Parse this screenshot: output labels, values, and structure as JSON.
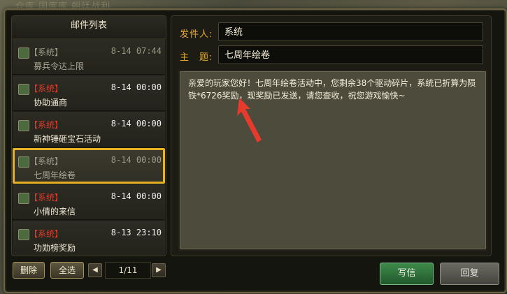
{
  "backdrop_tabs": "仓库  国库库  朝廷战利",
  "mail_list": {
    "title": "邮件列表",
    "items": [
      {
        "tag": "【系统】",
        "date": "8-14 07:44",
        "subject": "募兵令达上限",
        "read": true
      },
      {
        "tag": "【系统】",
        "date": "8-14 00:00",
        "subject": "协助通商",
        "read": false
      },
      {
        "tag": "【系统】",
        "date": "8-14 00:00",
        "subject": "新神锤砸宝石活动",
        "read": false
      },
      {
        "tag": "【系统】",
        "date": "8-14 00:00",
        "subject": "七周年绘卷",
        "read": true,
        "selected": true
      },
      {
        "tag": "【系统】",
        "date": "8-14 00:00",
        "subject": "小倩的来信",
        "read": false
      },
      {
        "tag": "【系统】",
        "date": "8-13 23:10",
        "subject": "功勋榜奖励",
        "read": false
      }
    ]
  },
  "controls": {
    "delete_label": "删除",
    "select_all_label": "全选",
    "page_indicator": "1/11"
  },
  "detail": {
    "sender_label": "发件人:",
    "sender_value": "系统",
    "subject_label": "主　题:",
    "subject_value": "七周年绘卷",
    "body_text": "亲爱的玩家您好！七周年绘卷活动中，您剩余38个驱动碎片，系统已折算为陨铁*6726奖励，现奖励已发送，请您查收，祝您游戏愉快~"
  },
  "actions": {
    "write_label": "写信",
    "reply_label": "回复"
  },
  "colors": {
    "accent_gold": "#e8b323",
    "label_orange": "#e4a82a",
    "unread_tag_red": "#e23a2a",
    "annotation_arrow_red": "#e53a2c"
  }
}
